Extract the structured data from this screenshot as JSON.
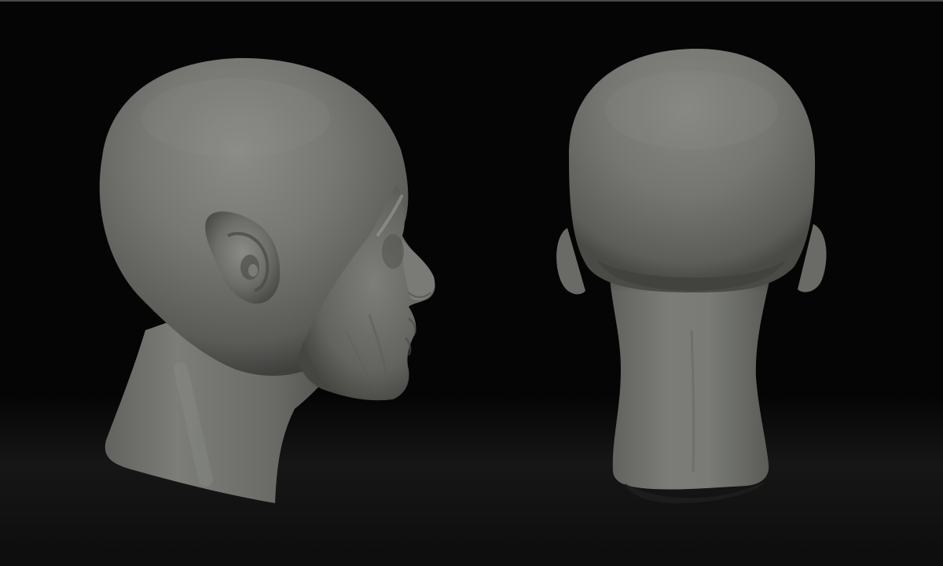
{
  "scene": {
    "background_color": "#050505",
    "model_color": "#6f706c",
    "views": [
      {
        "name": "head-side-view",
        "orientation": "right-profile"
      },
      {
        "name": "head-back-view",
        "orientation": "back"
      }
    ]
  }
}
